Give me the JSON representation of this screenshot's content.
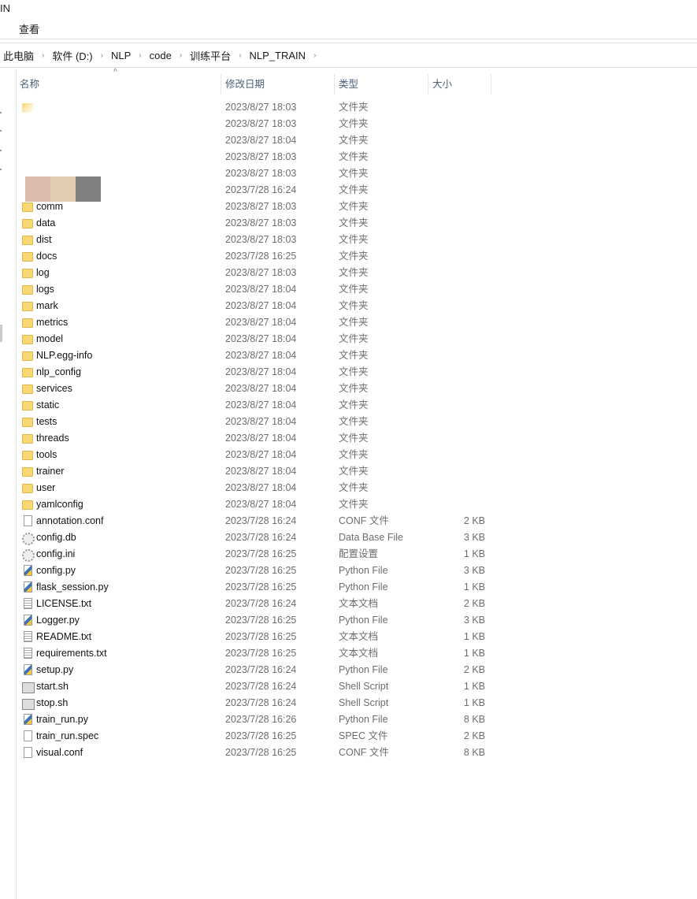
{
  "window": {
    "title": "IN",
    "menu_view": "查看"
  },
  "breadcrumb": [
    "此电脑",
    "软件 (D:)",
    "NLP",
    "code",
    "训练平台",
    "NLP_TRAIN"
  ],
  "columns": {
    "name": "名称",
    "date": "修改日期",
    "type": "类型",
    "size": "大小"
  },
  "files": [
    {
      "name": "",
      "date": "2023/8/27 18:03",
      "type": "文件夹",
      "size": "",
      "icon": "folder-icon"
    },
    {
      "name": "",
      "date": "2023/8/27 18:03",
      "type": "文件夹",
      "size": "",
      "icon": ""
    },
    {
      "name": "",
      "date": "2023/8/27 18:04",
      "type": "文件夹",
      "size": "",
      "icon": ""
    },
    {
      "name": "",
      "date": "2023/8/27 18:03",
      "type": "文件夹",
      "size": "",
      "icon": ""
    },
    {
      "name": "",
      "date": "2023/8/27 18:03",
      "type": "文件夹",
      "size": "",
      "icon": ""
    },
    {
      "name": "",
      "date": "2023/7/28 16:24",
      "type": "文件夹",
      "size": "",
      "icon": ""
    },
    {
      "name": "comm",
      "date": "2023/8/27 18:03",
      "type": "文件夹",
      "size": "",
      "icon": "folder-icon"
    },
    {
      "name": "data",
      "date": "2023/8/27 18:03",
      "type": "文件夹",
      "size": "",
      "icon": "folder-icon"
    },
    {
      "name": "dist",
      "date": "2023/8/27 18:03",
      "type": "文件夹",
      "size": "",
      "icon": "folder-icon"
    },
    {
      "name": "docs",
      "date": "2023/7/28 16:25",
      "type": "文件夹",
      "size": "",
      "icon": "folder-icon"
    },
    {
      "name": "log",
      "date": "2023/8/27 18:03",
      "type": "文件夹",
      "size": "",
      "icon": "folder-icon"
    },
    {
      "name": "logs",
      "date": "2023/8/27 18:04",
      "type": "文件夹",
      "size": "",
      "icon": "folder-icon"
    },
    {
      "name": "mark",
      "date": "2023/8/27 18:04",
      "type": "文件夹",
      "size": "",
      "icon": "folder-icon"
    },
    {
      "name": "metrics",
      "date": "2023/8/27 18:04",
      "type": "文件夹",
      "size": "",
      "icon": "folder-icon"
    },
    {
      "name": "model",
      "date": "2023/8/27 18:04",
      "type": "文件夹",
      "size": "",
      "icon": "folder-icon"
    },
    {
      "name": "NLP.egg-info",
      "date": "2023/8/27 18:04",
      "type": "文件夹",
      "size": "",
      "icon": "folder-icon"
    },
    {
      "name": "nlp_config",
      "date": "2023/8/27 18:04",
      "type": "文件夹",
      "size": "",
      "icon": "folder-icon"
    },
    {
      "name": "services",
      "date": "2023/8/27 18:04",
      "type": "文件夹",
      "size": "",
      "icon": "folder-icon"
    },
    {
      "name": "static",
      "date": "2023/8/27 18:04",
      "type": "文件夹",
      "size": "",
      "icon": "folder-icon"
    },
    {
      "name": "tests",
      "date": "2023/8/27 18:04",
      "type": "文件夹",
      "size": "",
      "icon": "folder-icon"
    },
    {
      "name": "threads",
      "date": "2023/8/27 18:04",
      "type": "文件夹",
      "size": "",
      "icon": "folder-icon"
    },
    {
      "name": "tools",
      "date": "2023/8/27 18:04",
      "type": "文件夹",
      "size": "",
      "icon": "folder-icon"
    },
    {
      "name": "trainer",
      "date": "2023/8/27 18:04",
      "type": "文件夹",
      "size": "",
      "icon": "folder-icon"
    },
    {
      "name": "user",
      "date": "2023/8/27 18:04",
      "type": "文件夹",
      "size": "",
      "icon": "folder-icon"
    },
    {
      "name": "yamlconfig",
      "date": "2023/8/27 18:04",
      "type": "文件夹",
      "size": "",
      "icon": "folder-icon"
    },
    {
      "name": "annotation.conf",
      "date": "2023/7/28 16:24",
      "type": "CONF 文件",
      "size": "2 KB",
      "icon": "file-icon"
    },
    {
      "name": "config.db",
      "date": "2023/7/28 16:24",
      "type": "Data Base File",
      "size": "3 KB",
      "icon": "database-file-icon"
    },
    {
      "name": "config.ini",
      "date": "2023/7/28 16:25",
      "type": "配置设置",
      "size": "1 KB",
      "icon": "settings-file-icon"
    },
    {
      "name": "config.py",
      "date": "2023/7/28 16:25",
      "type": "Python File",
      "size": "3 KB",
      "icon": "python-file-icon"
    },
    {
      "name": "flask_session.py",
      "date": "2023/7/28 16:25",
      "type": "Python File",
      "size": "1 KB",
      "icon": "python-file-icon"
    },
    {
      "name": "LICENSE.txt",
      "date": "2023/7/28 16:24",
      "type": "文本文档",
      "size": "2 KB",
      "icon": "text-file-icon"
    },
    {
      "name": "Logger.py",
      "date": "2023/7/28 16:25",
      "type": "Python File",
      "size": "3 KB",
      "icon": "python-file-icon"
    },
    {
      "name": "README.txt",
      "date": "2023/7/28 16:25",
      "type": "文本文档",
      "size": "1 KB",
      "icon": "text-file-icon"
    },
    {
      "name": "requirements.txt",
      "date": "2023/7/28 16:25",
      "type": "文本文档",
      "size": "1 KB",
      "icon": "text-file-icon"
    },
    {
      "name": "setup.py",
      "date": "2023/7/28 16:24",
      "type": "Python File",
      "size": "2 KB",
      "icon": "python-file-icon"
    },
    {
      "name": "start.sh",
      "date": "2023/7/28 16:24",
      "type": "Shell Script",
      "size": "1 KB",
      "icon": "shell-script-icon"
    },
    {
      "name": "stop.sh",
      "date": "2023/7/28 16:24",
      "type": "Shell Script",
      "size": "1 KB",
      "icon": "shell-script-icon"
    },
    {
      "name": "train_run.py",
      "date": "2023/7/28 16:26",
      "type": "Python File",
      "size": "8 KB",
      "icon": "python-file-icon"
    },
    {
      "name": "train_run.spec",
      "date": "2023/7/28 16:25",
      "type": "SPEC 文件",
      "size": "2 KB",
      "icon": "file-icon"
    },
    {
      "name": "visual.conf",
      "date": "2023/7/28 16:25",
      "type": "CONF 文件",
      "size": "8 KB",
      "icon": "file-icon"
    }
  ],
  "redaction_colors": [
    "#d9bcab",
    "#e2cdb4",
    "#808080"
  ]
}
